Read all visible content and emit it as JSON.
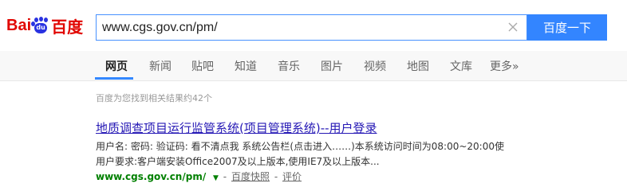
{
  "colors": {
    "brand_red": "#e10601",
    "brand_blue": "#2932e1",
    "accent": "#3385ff",
    "link": "#2518b5",
    "url_green": "#008000"
  },
  "logo": {
    "part1": "Bai",
    "part2": "du",
    "part3": "百度"
  },
  "search": {
    "value": "www.cgs.gov.cn/pm/",
    "button_label": "百度一下",
    "clear_icon": "close-icon"
  },
  "nav": {
    "tabs": [
      {
        "label": "网页",
        "active": true
      },
      {
        "label": "新闻"
      },
      {
        "label": "贴吧"
      },
      {
        "label": "知道"
      },
      {
        "label": "音乐"
      },
      {
        "label": "图片"
      },
      {
        "label": "视频"
      },
      {
        "label": "地图"
      },
      {
        "label": "文库"
      },
      {
        "label": "更多»"
      }
    ]
  },
  "stats": "百度为您找到相关结果约42个",
  "result": {
    "title": "地质调查项目运行监管系统(项目管理系统)--用户登录",
    "abstract_line1": "用户名: 密码: 验证码: 看不清点我 系统公告栏(点击进入……)本系统访问时间为08:00~20:00使",
    "abstract_line2": "用户要求:客户端安装Office2007及以上版本,使用IE7及以上版本...",
    "url": "www.cgs.gov.cn/pm/",
    "cache_label": "百度快照",
    "rate_label": "评价",
    "separator": "-"
  }
}
